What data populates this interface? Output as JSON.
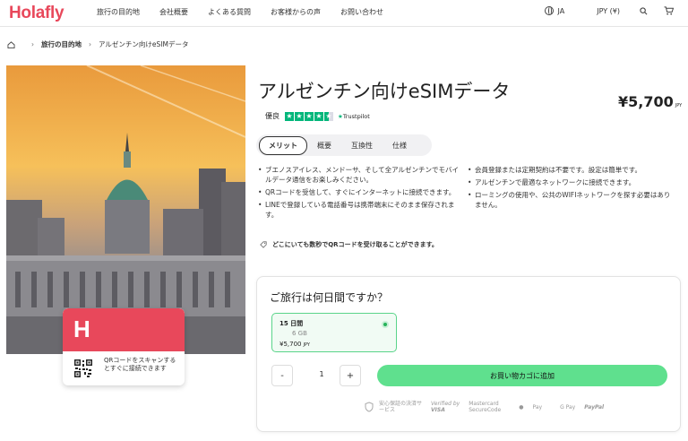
{
  "brand": {
    "logo": "Holafly",
    "accent": "#e8485b",
    "cta": "#5fe08e"
  },
  "nav": {
    "items": [
      "旅行の目的地",
      "会社概要",
      "よくある質問",
      "お客様からの声",
      "お問い合わせ"
    ],
    "language": "JA",
    "currency": "JPY (¥)"
  },
  "breadcrumb": {
    "level1": "旅行の目的地",
    "level2": "アルゼンチン向けeSIMデータ"
  },
  "product": {
    "title": "アルゼンチン向けeSIMデータ",
    "price": "¥5,700",
    "price_unit": "JPY",
    "rating_label": "優良",
    "trustpilot": "Trustpilot"
  },
  "tabs": [
    "メリット",
    "概要",
    "互換性",
    "仕様"
  ],
  "benefits_left": [
    "ブエノスアイレス、メンドーサ、そして全アルゼンチンでモバイルデータ通信をお楽しみください。",
    "QRコードを受信して、すぐにインターネットに接続できます。",
    "LINEで登録している電話番号は携帯端末にそのまま保存されます。"
  ],
  "benefits_right": [
    "会員登録または定期契約は不要です。設定は簡単です。",
    "アルゼンチンで最適なネットワークに接続できます。",
    "ローミングの使用や、公共のWIFIネットワークを探す必要はありません。"
  ],
  "note": "どこにいても数秒でQRコードを受け取ることができます。",
  "promo_card": {
    "logo": "H",
    "text": "QRコードをスキャンするとすぐに接続できます"
  },
  "purchase": {
    "question": "ご旅行は何日間ですか？",
    "plan": {
      "days": "15 日間",
      "data": "6 GB",
      "price": "¥5,700",
      "price_unit": "JPY"
    },
    "minus": "-",
    "quantity": "1",
    "plus": "+",
    "cart_button": "お買い物カゴに追加"
  },
  "payment": {
    "secure": "安心保証の決済サービス",
    "visa_top": "Verified by",
    "visa": "VISA",
    "mc_top": "Mastercard",
    "mc": "SecureCode",
    "apple": "Pay",
    "google": "G Pay",
    "paypal": "PayPal"
  }
}
